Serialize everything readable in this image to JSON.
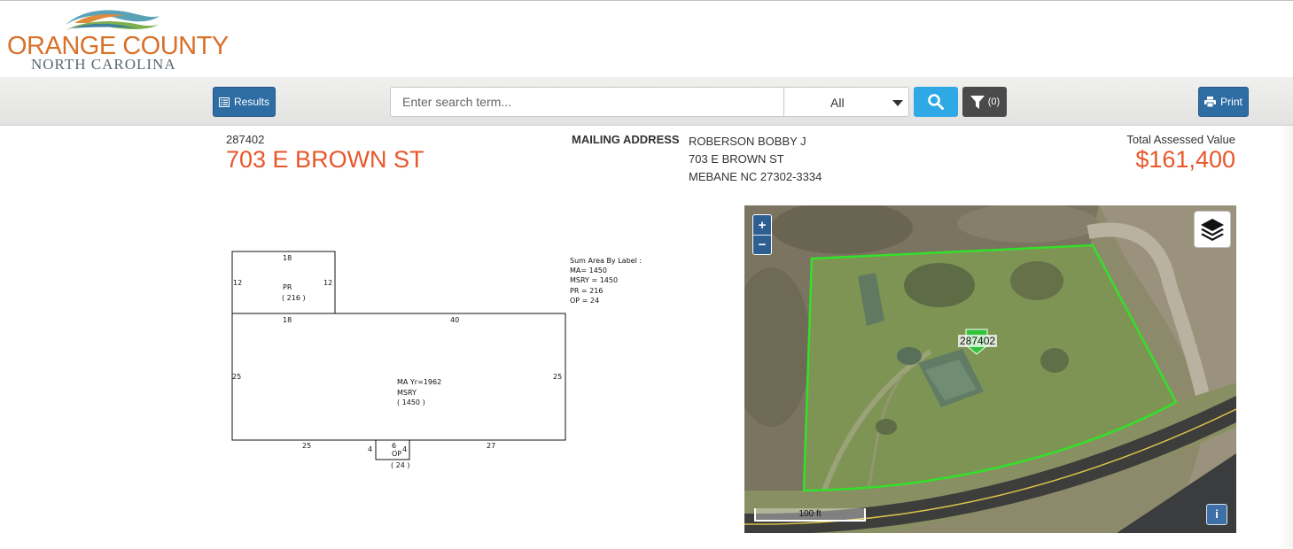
{
  "header": {
    "logo_text": "ORANGE COUNTY",
    "logo_subtext": "NORTH CAROLINA"
  },
  "toolbar": {
    "results_label": "Results",
    "search_placeholder": "Enter search term...",
    "search_value": "",
    "scope_selected": "All",
    "filter_count": "(0)",
    "print_label": "Print"
  },
  "property": {
    "parcel_id": "287402",
    "address": "703 E BROWN ST",
    "mailing_label": "MAILING ADDRESS",
    "mailing_name": "ROBERSON BOBBY J",
    "mailing_street": "703 E BROWN ST",
    "mailing_city": "MEBANE NC 27302-3334",
    "assessed_label": "Total Assessed Value",
    "assessed_value": "$161,400"
  },
  "sketch": {
    "legend_title": "Sum Area By Label :",
    "legend_lines": [
      "MA= 1450",
      "MSRY = 1450",
      "PR = 216",
      "OP = 24"
    ],
    "pr_top": "18",
    "pr_left": "12",
    "pr_right": "12",
    "pr_label": "PR",
    "pr_area": "( 216 )",
    "ma_top_left": "18",
    "ma_top_right": "40",
    "ma_left": "25",
    "ma_right": "25",
    "ma_label": "MA Yr=1962",
    "ma_msry": "MSRY",
    "ma_area": "( 1450 )",
    "ma_bottom_left": "25",
    "ma_bottom_right": "27",
    "op_left": "4",
    "op_top": "6",
    "op_right": "4",
    "op_label": "OP",
    "op_area": "( 24 )"
  },
  "map": {
    "parcel_label": "287402",
    "zoom_in": "+",
    "zoom_out": "−",
    "scale_label": "100 ft",
    "info_label": "i",
    "parcel_outline_color": "#33e02a"
  },
  "colors": {
    "accent_orange": "#e8572a",
    "button_blue": "#2e6da4",
    "search_blue": "#2ea9e6"
  }
}
